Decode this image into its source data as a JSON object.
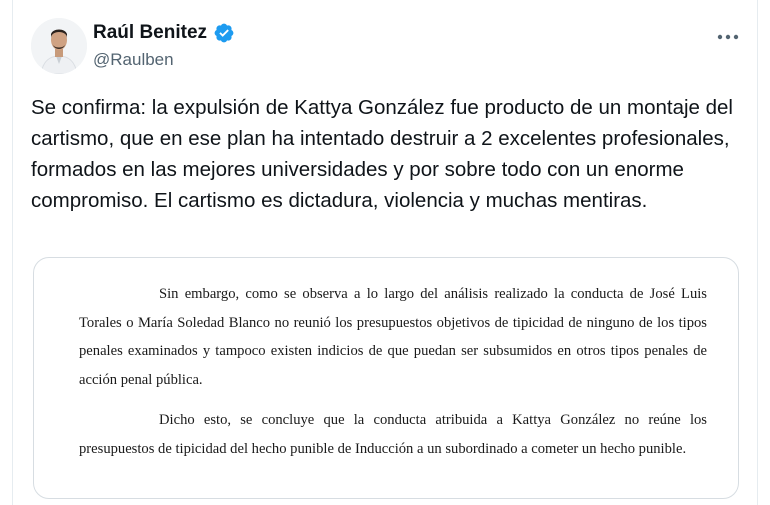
{
  "tweet": {
    "author_name": "Raúl Benitez",
    "author_handle": "@Raulben",
    "verified": true,
    "more_icon": "more-horizontal-icon",
    "text": "Se confirma: la expulsión de Kattya González fue producto de un montaje del cartismo, que en ese plan ha intentado destruir a 2 excelentes profesionales, formados en las mejores universidades y por sobre todo con un enorme compromiso. El cartismo es dictadura, violencia y muchas mentiras."
  },
  "document": {
    "paragraph_1": "Sin embargo, como se observa a lo largo del análisis realizado la conducta de José Luis Torales o María Soledad Blanco no reunió los presupuestos objetivos de tipicidad de ninguno de los tipos penales examinados y tampoco existen indicios de que puedan ser subsumidos en otros tipos penales de acción penal pública.",
    "paragraph_2": "Dicho esto, se concluye que la conducta atribuida a Kattya González no reúne los presupuestos de tipicidad del hecho punible de Inducción a un subordinado a cometer un hecho punible."
  },
  "colors": {
    "verified_blue": "#1d9bf0",
    "handle_gray": "#536471",
    "text_dark": "#0f1419"
  }
}
